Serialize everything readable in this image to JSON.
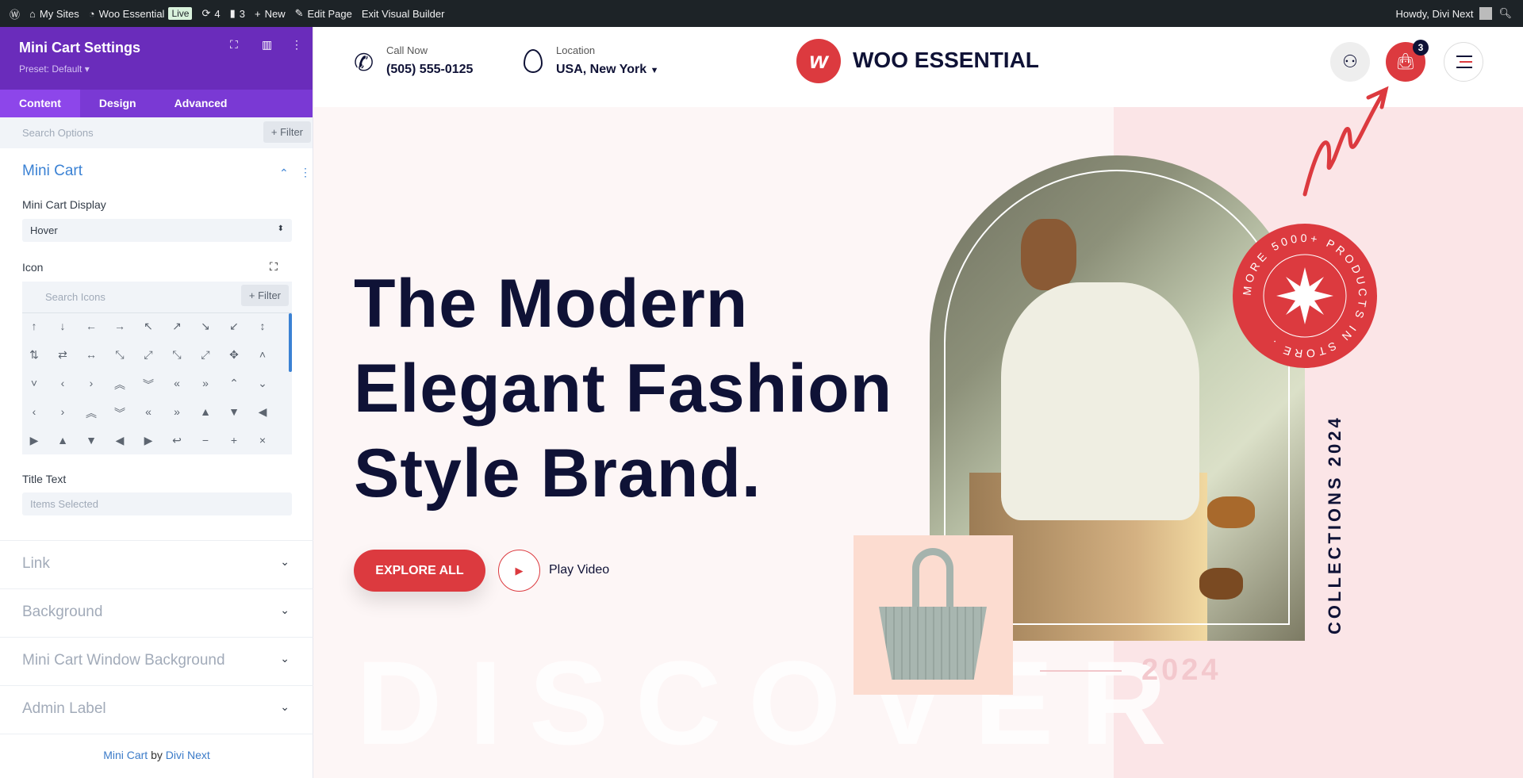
{
  "adminbar": {
    "my_sites": "My Sites",
    "site": "Woo Essential",
    "live": "Live",
    "updates": "4",
    "comments": "3",
    "new": "New",
    "edit_page": "Edit Page",
    "exit": "Exit Visual Builder",
    "howdy": "Howdy, Divi Next"
  },
  "panel": {
    "title": "Mini Cart Settings",
    "preset": "Preset: Default ▾",
    "tabs": [
      "Content",
      "Design",
      "Advanced"
    ],
    "search_placeholder": "Search Options",
    "filter": "+ Filter",
    "section": "Mini Cart",
    "display_label": "Mini Cart Display",
    "display_value": "Hover",
    "icon_label": "Icon",
    "icon_search_placeholder": "Search Icons",
    "icon_filter": "+ Filter",
    "icons": [
      "↑",
      "↓",
      "←",
      "→",
      "↖",
      "↗",
      "↘",
      "↙",
      "↕",
      "⇅",
      "⇄",
      "↔",
      "⤡",
      "⤢",
      "⤡",
      "⤢",
      "✥",
      "˄",
      "˅",
      "‹",
      "›",
      "︽",
      "︾",
      "«",
      "»",
      "⌃",
      "⌄",
      "‹",
      "›",
      "︽",
      "︾",
      "«",
      "»",
      "▲",
      "▼",
      "◀",
      "▶",
      "▲",
      "▼",
      "◀",
      "▶",
      "↩",
      "−",
      "+",
      "×"
    ],
    "title_text_label": "Title Text",
    "title_text_placeholder": "Items Selected",
    "collapsed": [
      "Link",
      "Background",
      "Mini Cart Window Background",
      "Admin Label"
    ],
    "footer": {
      "module": "Mini Cart",
      "by": " by ",
      "author": "Divi Next"
    }
  },
  "header": {
    "call_label": "Call Now",
    "phone": "(505) 555-0125",
    "location_label": "Location",
    "location": "USA, New York",
    "logo": "WOO ESSENTIAL",
    "cart_count": "3"
  },
  "hero": {
    "headline": [
      "The Modern",
      "Elegant Fashion",
      "Style Brand."
    ],
    "explore": "EXPLORE ALL",
    "play": "Play Video",
    "discover": "DISCOVER",
    "year": "2024",
    "collections": "COLLECTIONS 2024",
    "badge": "MORE 5000+ PRODUCTS IN STORE ."
  },
  "colors": {
    "accent": "#dc3a3f",
    "navy": "#0f1236",
    "purple": "#6a2cbb",
    "blue": "#3b82d4"
  }
}
